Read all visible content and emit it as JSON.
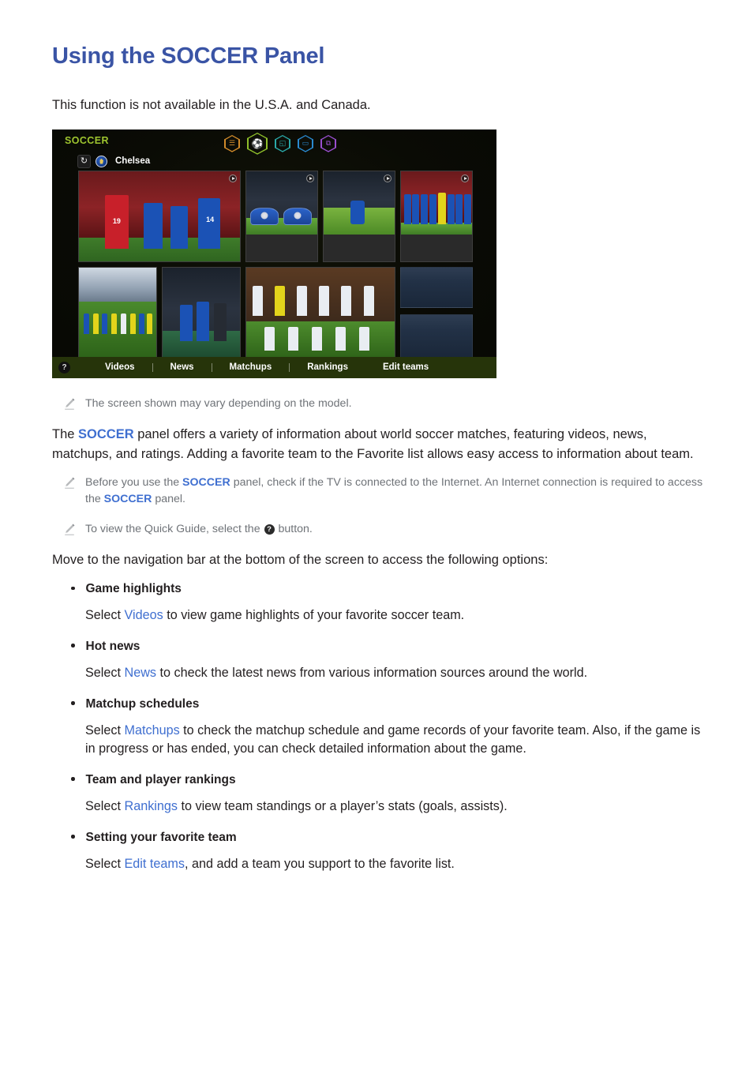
{
  "page": {
    "title": "Using the SOCCER Panel",
    "intro": "This function is not available in the U.S.A. and Canada."
  },
  "tv_panel": {
    "brand": "SOCCER",
    "favorite_team": "Chelsea",
    "refresh_icon": "refresh-icon",
    "team_badge_icon": "chelsea-badge-icon",
    "header_icons": [
      {
        "name": "news-list-icon",
        "glyph": "☰",
        "color": "#d08a2a",
        "selected": false
      },
      {
        "name": "soccer-ball-icon",
        "glyph": "⚽",
        "color": "#8fbf2a",
        "selected": true
      },
      {
        "name": "apps-icon",
        "glyph": "◱",
        "color": "#2aa8a8",
        "selected": false
      },
      {
        "name": "tv-icon",
        "glyph": "▭",
        "color": "#2a8ad0",
        "selected": false
      },
      {
        "name": "multi-window-icon",
        "glyph": "⧉",
        "color": "#9a4fd0",
        "selected": false
      }
    ],
    "nav_items": [
      {
        "label": "Videos"
      },
      {
        "label": "News"
      },
      {
        "label": "Matchups"
      },
      {
        "label": "Rankings"
      },
      {
        "label": "Edit teams"
      }
    ],
    "help_button": "?",
    "thumbnails": [
      {
        "name": "thumb-match-highlight",
        "kind": "photo",
        "has_play": true
      },
      {
        "name": "thumb-team-banner",
        "kind": "photo",
        "has_play": true
      },
      {
        "name": "thumb-goal-celebration",
        "kind": "photo",
        "has_play": true
      },
      {
        "name": "thumb-team-lineup",
        "kind": "photo",
        "has_play": true
      },
      {
        "name": "thumb-squad-photo",
        "kind": "photo",
        "has_play": false
      },
      {
        "name": "thumb-match-action",
        "kind": "photo",
        "has_play": false
      },
      {
        "name": "thumb-team-group",
        "kind": "photo",
        "has_play": false
      },
      {
        "name": "thumb-placeholder-top",
        "kind": "placeholder",
        "has_play": false
      },
      {
        "name": "thumb-placeholder-bottom",
        "kind": "placeholder",
        "has_play": false
      }
    ]
  },
  "notes": {
    "screen_varies": "The screen shown may vary depending on the model.",
    "internet_part1": "Before you use the ",
    "internet_kw1": "SOCCER",
    "internet_part2": " panel, check if the TV is connected to the Internet. An Internet connection is required to access the ",
    "internet_kw2": "SOCCER",
    "internet_part3": " panel.",
    "quick_guide_part1": "To view the Quick Guide, select the ",
    "quick_guide_button": "?",
    "quick_guide_part2": " button."
  },
  "description": {
    "part1": "The ",
    "keyword": "SOCCER",
    "part2": " panel offers a variety of information about world soccer matches, featuring videos, news, matchups, and ratings. Adding a favorite team to the Favorite list allows easy access to information about team."
  },
  "move_to_nav": "Move to the navigation bar at the bottom of the screen to access the following options:",
  "options": [
    {
      "title": "Game highlights",
      "body_part1": "Select ",
      "link": "Videos",
      "body_part2": " to view game highlights of your favorite soccer team."
    },
    {
      "title": "Hot news",
      "body_part1": "Select ",
      "link": "News",
      "body_part2": " to check the latest news from various information sources around the world."
    },
    {
      "title": "Matchup schedules",
      "body_part1": "Select ",
      "link": "Matchups",
      "body_part2": " to check the matchup schedule and game records of your favorite team. Also, if the game is in progress or has ended, you can check detailed information about the game."
    },
    {
      "title": "Team and player rankings",
      "body_part1": "Select ",
      "link": "Rankings",
      "body_part2": " to view team standings or a player’s stats (goals, assists)."
    },
    {
      "title": "Setting your favorite team",
      "body_part1": "Select ",
      "link": "Edit teams",
      "body_part2": ", and add a team you support to the favorite list."
    }
  ],
  "colors": {
    "title_blue": "#3a54a5",
    "link_blue": "#3f6fd0",
    "brand_green": "#9ec52f",
    "nav_bar_green": "#26340a",
    "note_gray": "#6f7378"
  }
}
